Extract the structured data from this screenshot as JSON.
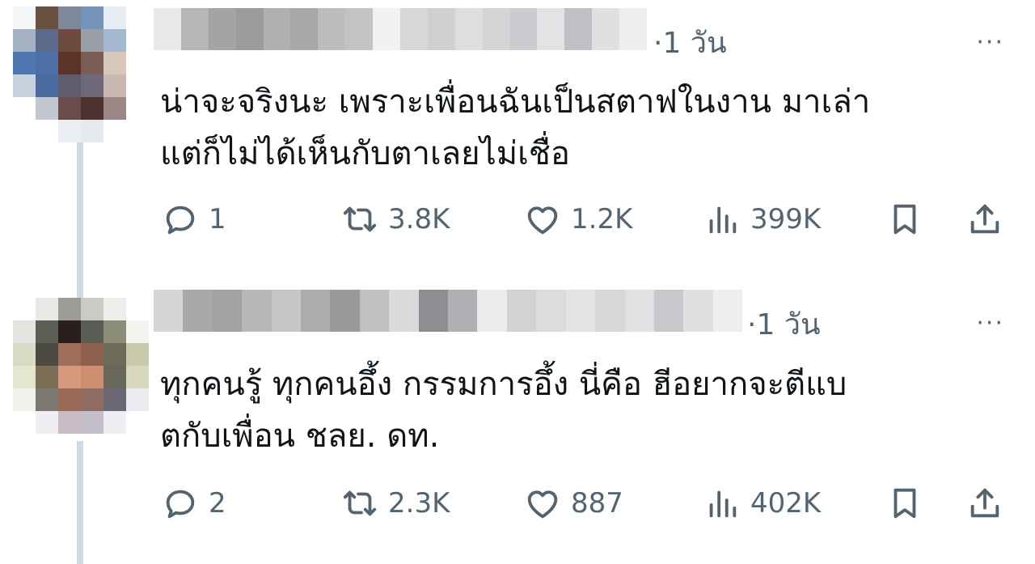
{
  "tweets": [
    {
      "time": "·1 วัน",
      "more": "···",
      "text_lines": [
        "น่าจะจริงนะ เพราะเพื่อนฉันเป็นสตาฟในงาน มาเล่า",
        "แต่ก็ไม่ได้เห็นกับตาเลยไม่เชื่อ"
      ],
      "replies": "1",
      "retweets": "3.8K",
      "likes": "1.2K",
      "views": "399K"
    },
    {
      "time": "·1 วัน",
      "more": "···",
      "text_lines": [
        "ทุกคนรู้ ทุกคนอึ้ง กรรมการอึ้ง นี่คือ ฮีอยากจะตีแบ",
        "ตกับเพื่อน ชลย. ดท."
      ],
      "replies": "2",
      "retweets": "2.3K",
      "likes": "887",
      "views": "402K"
    }
  ],
  "icons": {
    "reply": "reply-bubble-icon",
    "retweet": "retweet-arrows-icon",
    "like": "heart-icon",
    "views": "bar-chart-icon",
    "bookmark": "bookmark-icon",
    "share": "share-upload-icon"
  },
  "colors": {
    "text_primary": "#0f1419",
    "text_secondary": "#536471",
    "thread_line": "#cfd9de"
  }
}
